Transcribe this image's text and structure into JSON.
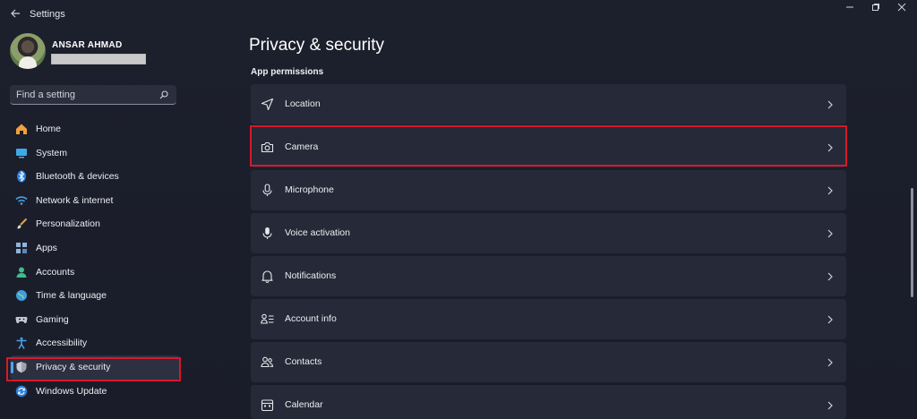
{
  "window": {
    "title": "Settings",
    "back_icon": "back-arrow-icon",
    "controls": [
      "minimize",
      "restore",
      "close"
    ]
  },
  "profile": {
    "name": "ANSAR AHMAD"
  },
  "search": {
    "placeholder": "Find a setting",
    "icon": "search-icon"
  },
  "sidebar": {
    "items": [
      {
        "label": "Home",
        "icon": "home-icon"
      },
      {
        "label": "System",
        "icon": "system-icon"
      },
      {
        "label": "Bluetooth & devices",
        "icon": "bluetooth-icon"
      },
      {
        "label": "Network & internet",
        "icon": "wifi-icon"
      },
      {
        "label": "Personalization",
        "icon": "brush-icon"
      },
      {
        "label": "Apps",
        "icon": "apps-icon"
      },
      {
        "label": "Accounts",
        "icon": "accounts-icon"
      },
      {
        "label": "Time & language",
        "icon": "globe-icon"
      },
      {
        "label": "Gaming",
        "icon": "gamepad-icon"
      },
      {
        "label": "Accessibility",
        "icon": "accessibility-icon"
      },
      {
        "label": "Privacy & security",
        "icon": "shield-icon",
        "selected": true
      },
      {
        "label": "Windows Update",
        "icon": "update-icon"
      }
    ]
  },
  "main": {
    "title": "Privacy & security",
    "section": "App permissions",
    "items": [
      {
        "label": "Location",
        "icon": "location-icon"
      },
      {
        "label": "Camera",
        "icon": "camera-icon",
        "highlighted": true
      },
      {
        "label": "Microphone",
        "icon": "microphone-icon"
      },
      {
        "label": "Voice activation",
        "icon": "voice-activation-icon"
      },
      {
        "label": "Notifications",
        "icon": "bell-icon"
      },
      {
        "label": "Account info",
        "icon": "account-info-icon"
      },
      {
        "label": "Contacts",
        "icon": "contacts-icon"
      },
      {
        "label": "Calendar",
        "icon": "calendar-icon"
      }
    ]
  },
  "colors": {
    "background": "#1b1e2a",
    "card": "#262a38",
    "accent": "#4da3ff",
    "highlight": "#d8182b"
  }
}
